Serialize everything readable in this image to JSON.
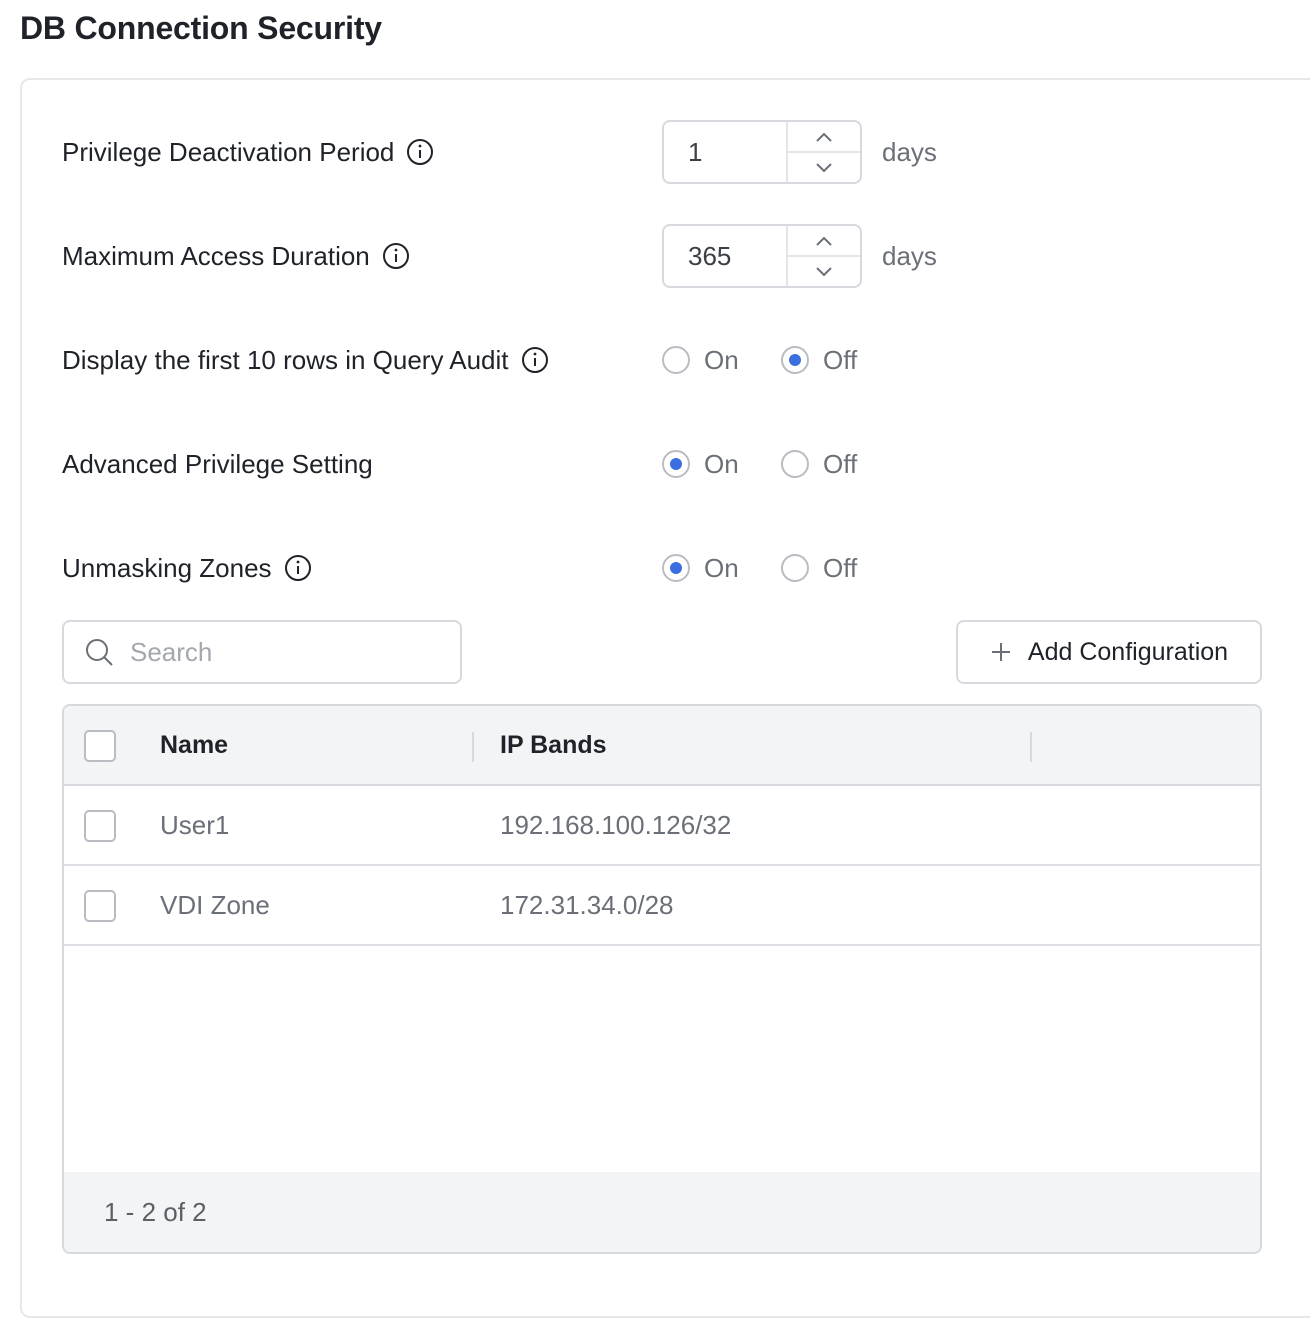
{
  "page": {
    "title": "DB Connection Security"
  },
  "settings": {
    "privilege_deactivation": {
      "label": "Privilege Deactivation Period",
      "value": "1",
      "unit": "days"
    },
    "max_access_duration": {
      "label": "Maximum Access Duration",
      "value": "365",
      "unit": "days"
    },
    "query_audit": {
      "label": "Display the first 10 rows in Query Audit",
      "on_label": "On",
      "off_label": "Off",
      "selected": "off"
    },
    "advanced_privilege": {
      "label": "Advanced Privilege Setting",
      "on_label": "On",
      "off_label": "Off",
      "selected": "on"
    },
    "unmasking_zones": {
      "label": "Unmasking Zones",
      "on_label": "On",
      "off_label": "Off",
      "selected": "on"
    }
  },
  "search": {
    "placeholder": "Search",
    "value": ""
  },
  "toolbar": {
    "add_label": "Add Configuration"
  },
  "table": {
    "columns": [
      "Name",
      "IP Bands"
    ],
    "rows": [
      {
        "name": "User1",
        "ip": "192.168.100.126/32"
      },
      {
        "name": "VDI Zone",
        "ip": "172.31.34.0/28"
      }
    ],
    "pagination": "1 - 2 of 2"
  },
  "colors": {
    "accent": "#3a6fe0",
    "border": "#d6d9de",
    "header_bg": "#f3f4f6"
  },
  "icons": {
    "info": "info-icon",
    "chevron_up": "chevron-up-icon",
    "chevron_down": "chevron-down-icon",
    "search": "search-icon",
    "plus": "plus-icon"
  }
}
